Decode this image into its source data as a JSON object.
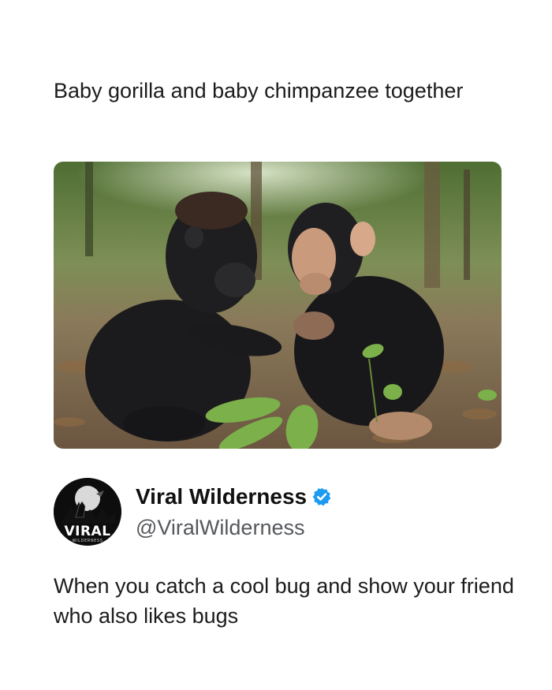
{
  "caption": "Baby gorilla and baby chimpanzee together",
  "photo": {
    "subject": "photo-gorilla-chimpanzee"
  },
  "author": {
    "display_name": "Viral Wilderness",
    "handle": "@ViralWilderness",
    "avatar_text": "VIRAL",
    "avatar_subtext": "WILDERNESS",
    "verified_color": "#1d9bf0"
  },
  "post_text": "When you catch a cool bug and show your friend who also likes bugs"
}
